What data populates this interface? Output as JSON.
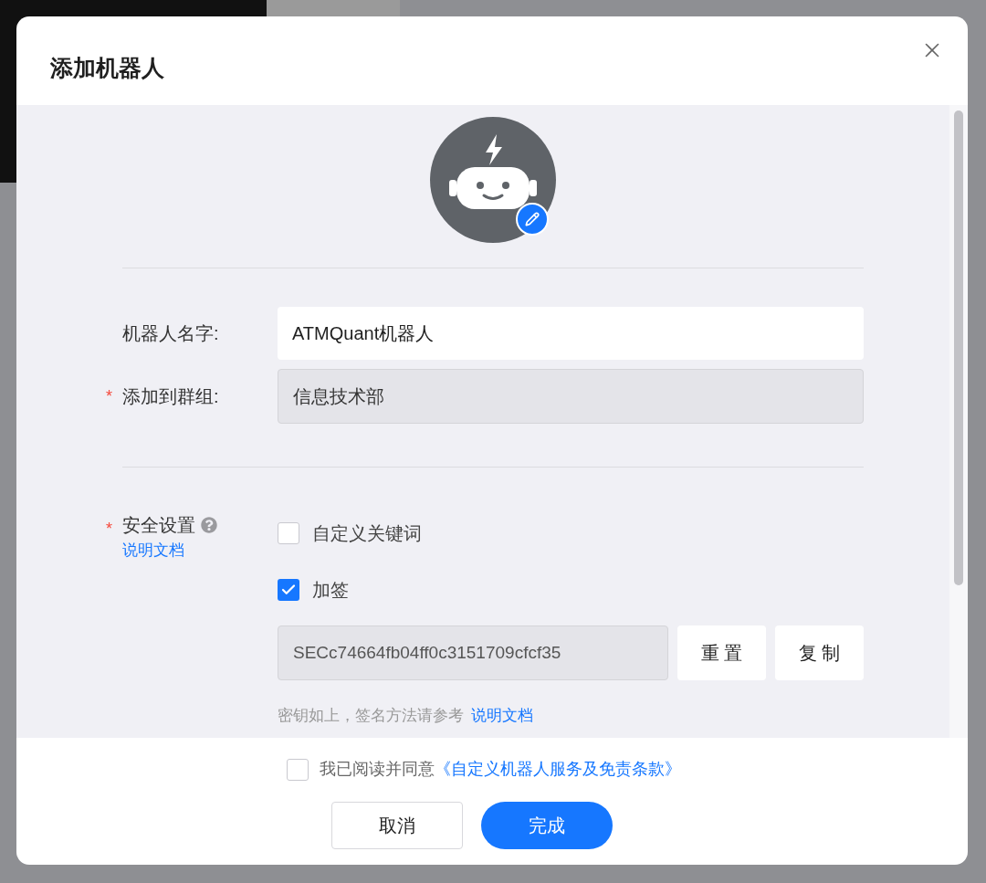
{
  "dialog": {
    "title": "添加机器人",
    "fields": [
      {
        "label": "机器人名字:",
        "disabled": false,
        "value": "ATMQuant机器人"
      },
      {
        "label": "添加到群组:",
        "required_mark": "*",
        "disabled": true,
        "value": "信息技术部"
      }
    ],
    "security": {
      "label": "安全设置",
      "required_mark": "*",
      "doc_link": "说明文档",
      "options": [
        {
          "label": "自定义关键词",
          "checked": false
        },
        {
          "label": "加签",
          "checked": true
        }
      ],
      "secret": {
        "value": "SECc74664fb04ff0c3151709cfcf35",
        "buttons": [
          "重 置",
          "复 制"
        ]
      },
      "hint": {
        "text": "密钥如上，签名方法请参考",
        "link": "说明文档"
      }
    },
    "footer": {
      "agreement": {
        "checked": false,
        "text": "我已阅读并同意",
        "link": "《自定义机器人服务及免责条款》"
      },
      "buttons": [
        {
          "label": "取消",
          "kind": "secondary"
        },
        {
          "label": "完成",
          "kind": "primary"
        }
      ]
    }
  }
}
